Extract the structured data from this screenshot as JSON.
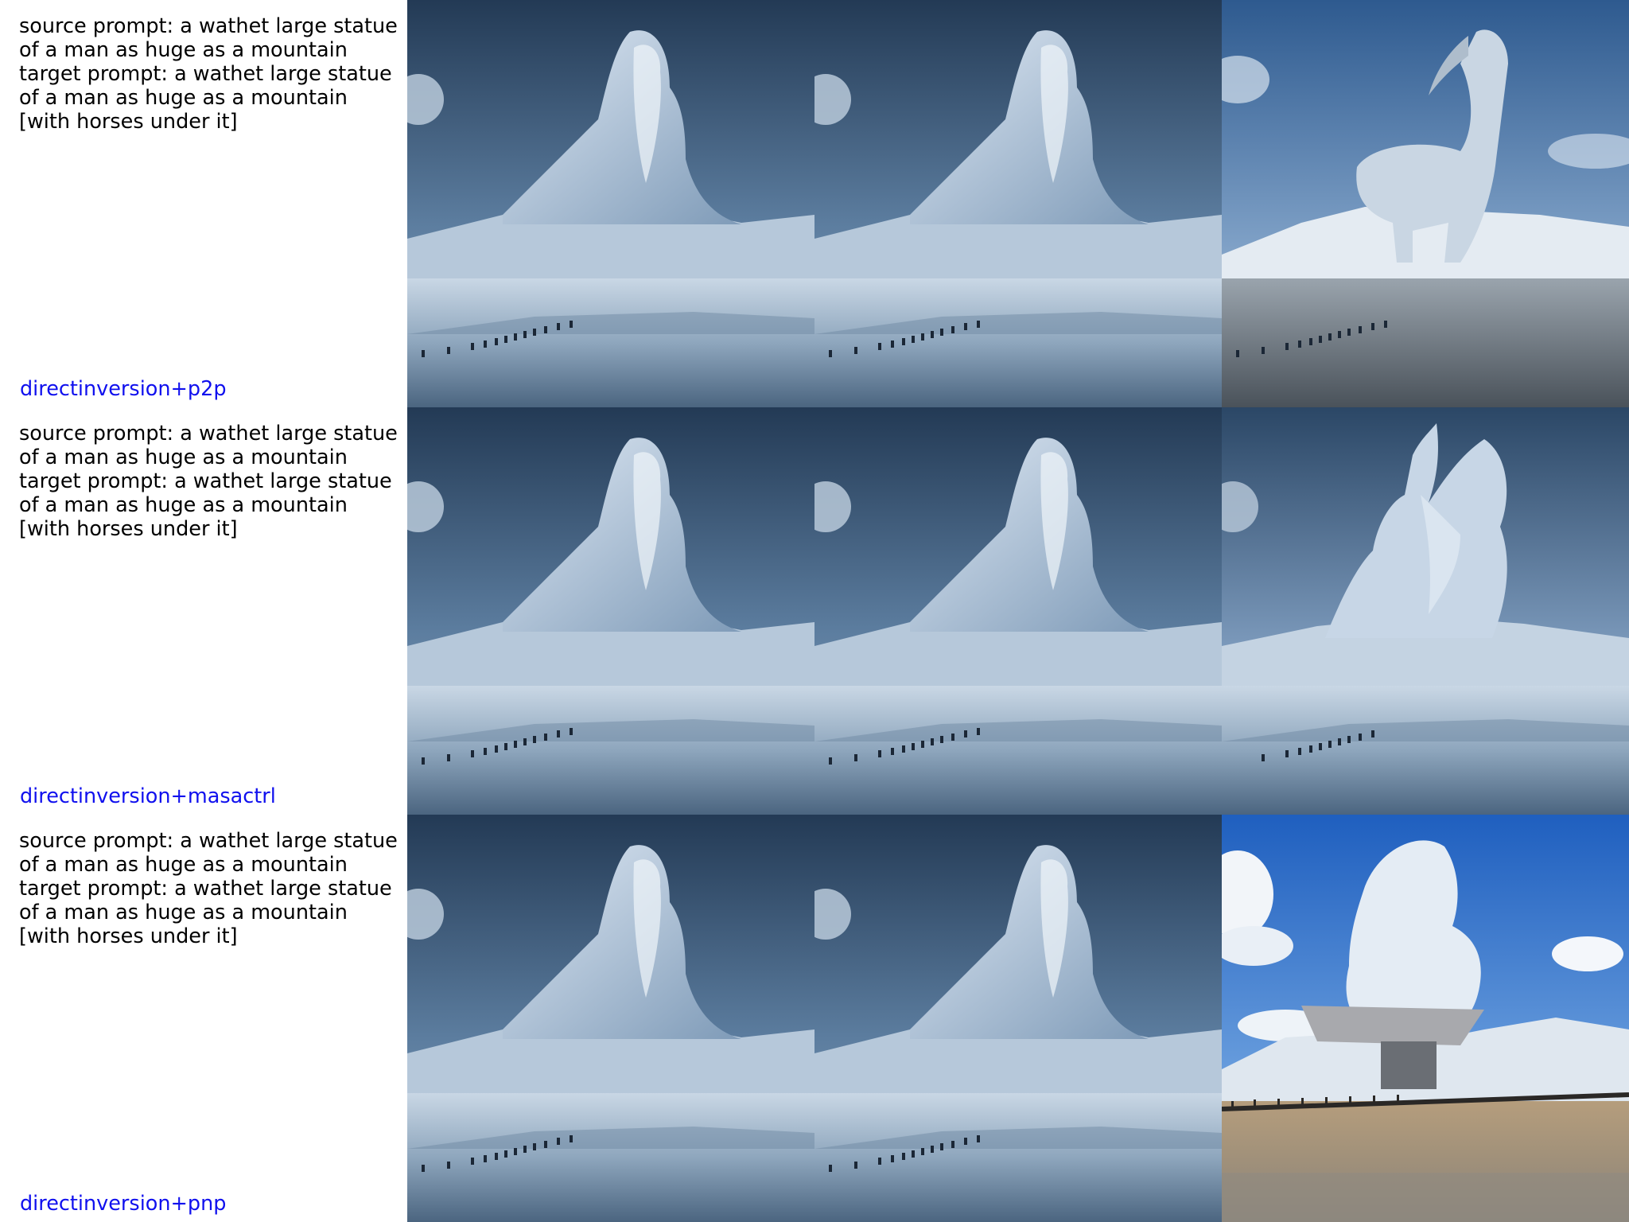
{
  "rows": [
    {
      "prompt_text": "source prompt: a wathet large statue of a man as huge as a mountain target prompt: a wathet large statue of a man as huge as a mountain [with horses under it]",
      "method_label": "directinversion+p2p",
      "images": [
        {
          "depicts": "man-statue",
          "sky": "blue"
        },
        {
          "depicts": "man-statue",
          "sky": "blue"
        },
        {
          "depicts": "horse-statue",
          "sky": "blue-cloudy"
        }
      ]
    },
    {
      "prompt_text": "source prompt: a wathet large statue of a man as huge as a mountain target prompt: a wathet large statue of a man as huge as a mountain [with horses under it]",
      "method_label": "directinversion+masactrl",
      "images": [
        {
          "depicts": "man-statue",
          "sky": "blue"
        },
        {
          "depicts": "man-statue",
          "sky": "blue"
        },
        {
          "depicts": "rider-statue",
          "sky": "blue-hazy"
        }
      ]
    },
    {
      "prompt_text": "source prompt: a wathet large statue of a man as huge as a mountain target prompt: a wathet large statue of a man as huge as a mountain [with horses under it]",
      "method_label": "directinversion+pnp",
      "images": [
        {
          "depicts": "man-statue",
          "sky": "blue"
        },
        {
          "depicts": "man-statue",
          "sky": "blue"
        },
        {
          "depicts": "statue-on-platform",
          "sky": "bright-blue-clouds"
        }
      ]
    }
  ],
  "colors": {
    "method_label": "#1010ee",
    "prompt_text": "#000000",
    "background": "#ffffff"
  }
}
